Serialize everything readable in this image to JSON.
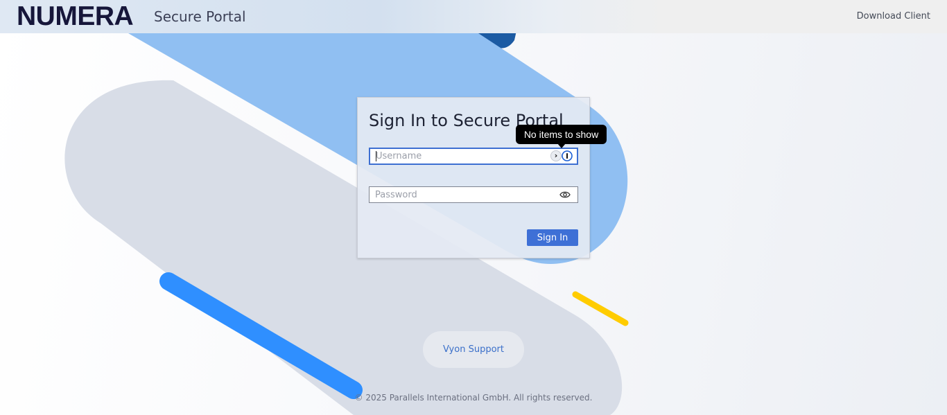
{
  "header": {
    "logo_text": "NUMERA",
    "portal_name": "Secure Portal",
    "download_label": "Download Client"
  },
  "login": {
    "title": "Sign In to Secure Portal",
    "username_placeholder": "Username",
    "password_placeholder": "Password",
    "signin_label": "Sign In",
    "pm_arrow_glyph": "›"
  },
  "tooltip": {
    "text": "No items to show"
  },
  "support": {
    "label": "Vyon Support"
  },
  "footer": {
    "copyright": "© 2025 Parallels International GmbH. All rights reserved."
  },
  "icons": {
    "password_manager": "onepassword-icon",
    "password_reveal": "eye-icon",
    "autofill_arrow": "chevron-right-icon"
  },
  "colors": {
    "brand_dark": "#16163a",
    "accent_blue": "#3e70d6",
    "light_blue_shape": "#90bff2",
    "bright_blue_stroke": "#2f8fff",
    "gray_shape": "#d8dde7",
    "yellow_stroke": "#ffcc00",
    "tooltip_bg": "#000000"
  }
}
